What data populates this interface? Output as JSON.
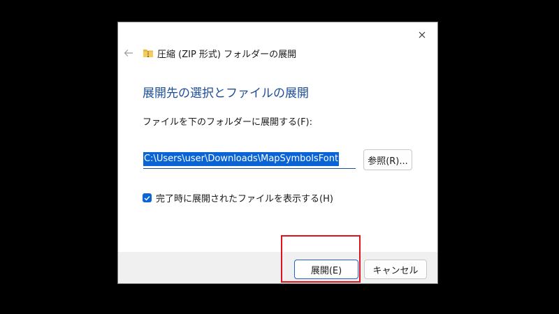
{
  "window": {
    "title": "圧縮 (ZIP 形式) フォルダーの展開",
    "back_icon": "back-arrow-icon",
    "folder_icon": "zip-folder-icon",
    "close_icon": "close-icon"
  },
  "main": {
    "heading": "展開先の選択とファイルの展開",
    "destination_label": "ファイルを下のフォルダーに展開する(F):",
    "path_value": "C:\\Users\\user\\Downloads\\MapSymbolsFont",
    "browse_label": "参照(R)...",
    "checkbox_label": "完了時に展開されたファイルを表示する(H)",
    "checkbox_checked": true
  },
  "footer": {
    "extract_label": "展開(E)",
    "cancel_label": "キャンセル"
  },
  "colors": {
    "accent": "#0a64d6",
    "heading": "#1f4e99",
    "highlight": "#e0121b"
  }
}
